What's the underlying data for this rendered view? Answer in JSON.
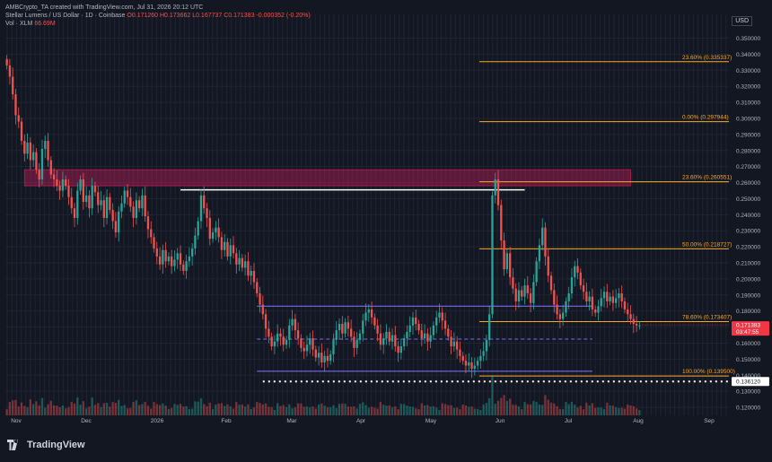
{
  "header": {
    "creator": "AMBCrypto_TA created with TradingView.com, Jul 31, 2026 20:12 UTC",
    "symbol": "Stellar Lumens / US Dollar · 1D · Coinbase",
    "ohlc": "O0.171260 H0.173662 L0.167737 C0.171383 -0.000352 (-0.20%)",
    "volume_label": "Vol · XLM",
    "volume_value": "66.69M"
  },
  "currency": "USD",
  "footer": {
    "brand": "TradingView"
  },
  "colors": {
    "background": "#131722",
    "up": "#26a69a",
    "down": "#ef5350",
    "fib": "#f9a825",
    "zone": "#e91e63",
    "channel": "#7b68ee",
    "price_badge": "#f23645"
  },
  "chart_data": {
    "type": "candlestick",
    "x_tick_labels": [
      "Nov",
      "Dec",
      "2026",
      "Feb",
      "Mar",
      "Apr",
      "May",
      "Jun",
      "Jul",
      "Aug",
      "Sep"
    ],
    "y_tick_labels": [
      "0.350000",
      "0.340000",
      "0.330000",
      "0.320000",
      "0.310000",
      "0.300000",
      "0.290000",
      "0.280000",
      "0.270000",
      "0.260000",
      "0.250000",
      "0.240000",
      "0.230000",
      "0.220000",
      "0.210000",
      "0.200000",
      "0.190000",
      "0.180000",
      "0.170000",
      "0.160000",
      "0.150000",
      "0.140000",
      "0.130000",
      "0.120000"
    ],
    "ylim": [
      0.115,
      0.357
    ],
    "fib_levels": [
      {
        "label": "23.60% (0.335337)",
        "value": 0.335337
      },
      {
        "label": "0.00% (0.297944)",
        "value": 0.297944
      },
      {
        "label": "23.60% (0.260551)",
        "value": 0.260551
      },
      {
        "label": "50.00% (0.218727)",
        "value": 0.218727
      },
      {
        "label": "78.60% (0.173407)",
        "value": 0.173407
      },
      {
        "label": "100.00% (0.139500)",
        "value": 0.1395
      }
    ],
    "current_price": {
      "value": 0.171383,
      "label": "0.171383",
      "countdown": "03:47:55"
    },
    "support_line": {
      "value": 0.13612,
      "label": "0.136120"
    },
    "resistance_line": {
      "value": 0.2555
    },
    "supply_zone": {
      "top": 0.268,
      "bottom": 0.258
    },
    "channel": {
      "top": 0.183,
      "mid": 0.1625,
      "bottom": 0.1425
    },
    "closes": [
      0.333,
      0.326,
      0.315,
      0.302,
      0.298,
      0.286,
      0.278,
      0.285,
      0.274,
      0.279,
      0.268,
      0.262,
      0.281,
      0.286,
      0.274,
      0.265,
      0.262,
      0.258,
      0.255,
      0.262,
      0.258,
      0.251,
      0.244,
      0.238,
      0.255,
      0.262,
      0.248,
      0.252,
      0.244,
      0.258,
      0.254,
      0.246,
      0.249,
      0.238,
      0.251,
      0.243,
      0.236,
      0.229,
      0.242,
      0.247,
      0.255,
      0.251,
      0.245,
      0.238,
      0.249,
      0.244,
      0.252,
      0.239,
      0.231,
      0.226,
      0.219,
      0.214,
      0.209,
      0.218,
      0.211,
      0.214,
      0.208,
      0.212,
      0.216,
      0.209,
      0.205,
      0.211,
      0.214,
      0.219,
      0.227,
      0.236,
      0.252,
      0.244,
      0.238,
      0.225,
      0.229,
      0.232,
      0.226,
      0.218,
      0.223,
      0.214,
      0.221,
      0.216,
      0.209,
      0.213,
      0.207,
      0.211,
      0.202,
      0.205,
      0.198,
      0.191,
      0.184,
      0.178,
      0.169,
      0.164,
      0.158,
      0.161,
      0.166,
      0.164,
      0.159,
      0.162,
      0.171,
      0.175,
      0.168,
      0.163,
      0.157,
      0.155,
      0.159,
      0.163,
      0.156,
      0.151,
      0.154,
      0.148,
      0.152,
      0.149,
      0.153,
      0.162,
      0.168,
      0.172,
      0.166,
      0.173,
      0.169,
      0.164,
      0.157,
      0.162,
      0.166,
      0.174,
      0.179,
      0.181,
      0.176,
      0.171,
      0.166,
      0.159,
      0.163,
      0.167,
      0.161,
      0.165,
      0.158,
      0.154,
      0.158,
      0.163,
      0.167,
      0.171,
      0.176,
      0.172,
      0.168,
      0.163,
      0.166,
      0.161,
      0.165,
      0.171,
      0.176,
      0.179,
      0.174,
      0.169,
      0.164,
      0.158,
      0.161,
      0.156,
      0.152,
      0.149,
      0.146,
      0.148,
      0.144,
      0.146,
      0.149,
      0.152,
      0.155,
      0.162,
      0.178,
      0.252,
      0.262,
      0.246,
      0.224,
      0.206,
      0.216,
      0.201,
      0.194,
      0.186,
      0.193,
      0.189,
      0.196,
      0.191,
      0.185,
      0.198,
      0.211,
      0.221,
      0.232,
      0.214,
      0.202,
      0.193,
      0.184,
      0.178,
      0.175,
      0.179,
      0.186,
      0.191,
      0.201,
      0.208,
      0.204,
      0.196,
      0.192,
      0.186,
      0.189,
      0.181,
      0.179,
      0.183,
      0.188,
      0.192,
      0.186,
      0.189,
      0.185,
      0.188,
      0.191,
      0.186,
      0.181,
      0.178,
      0.175,
      0.172,
      0.171,
      0.171
    ]
  }
}
